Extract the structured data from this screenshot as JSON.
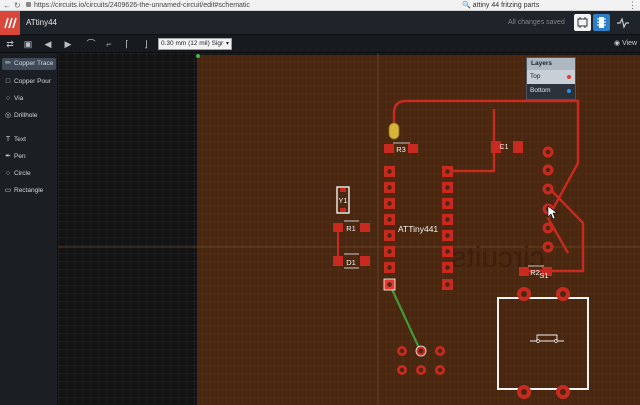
{
  "browser": {
    "url": "https://circuits.io/circuits/2409626-the-unnamed-circuit/edit#schematic",
    "search": "attiny 44 fritzing parts"
  },
  "header": {
    "project_title": "ATtiny44",
    "status": "All changes saved"
  },
  "toolbar": {
    "trace_width": "0.30 mm (12 mil) Sigr",
    "view_label": "View"
  },
  "sidebar": {
    "items": [
      {
        "label": "Copper Trace",
        "icon": "pencil-icon"
      },
      {
        "label": "Copper Pour",
        "icon": "square-icon"
      },
      {
        "label": "Via",
        "icon": "ring-icon"
      },
      {
        "label": "Drillhole",
        "icon": "target-icon"
      },
      {
        "label": "Text",
        "icon": "text-icon"
      },
      {
        "label": "Pen",
        "icon": "pen-icon"
      },
      {
        "label": "Circle",
        "icon": "circle-icon"
      },
      {
        "label": "Rectangle",
        "icon": "rectangle-icon"
      }
    ]
  },
  "layers": {
    "title": "Layers",
    "items": [
      {
        "label": "Top",
        "color": "#e23b2e"
      },
      {
        "label": "Bottom",
        "color": "#2f8fe0"
      }
    ]
  },
  "pcb": {
    "board_color": "#4a2710",
    "copper_color": "#c82a20",
    "silk_color": "#f2f2f2",
    "labels": {
      "r3": "R3",
      "c1": "C1",
      "y1": "Y1",
      "r1": "R1",
      "d1": "D1",
      "chip": "ATTiny441",
      "r2": "R2",
      "s1": "S1"
    },
    "watermark": "circuits"
  }
}
